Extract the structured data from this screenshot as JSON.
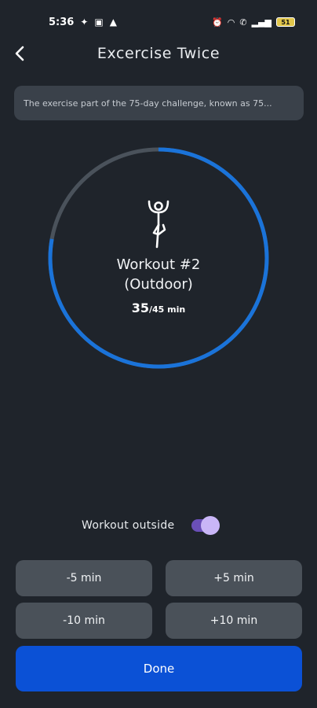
{
  "status_bar": {
    "time": "5:36",
    "battery": "51",
    "icons": [
      "messenger-icon",
      "chat-icon",
      "warning-icon",
      "alarm-icon",
      "wifi-icon",
      "call-icon",
      "signal-icon",
      "battery-icon"
    ]
  },
  "header": {
    "title": "Excercise Twice",
    "back_icon": "chevron-left-icon"
  },
  "description": "The exercise part of the 75-day challenge, known as 75...",
  "workout": {
    "name": "Workout #2",
    "type": "(Outdoor)",
    "elapsed": "35",
    "total": "/45 min",
    "progress_fraction": 0.7778,
    "icon": "yoga-pose-icon"
  },
  "toggle": {
    "label": "Workout outside",
    "on": true
  },
  "buttons": {
    "minus5": "-5 min",
    "plus5": "+5 min",
    "minus10": "-10 min",
    "plus10": "+10 min",
    "done": "Done"
  },
  "colors": {
    "background": "#1f242b",
    "ring_progress": "#1a73d9",
    "ring_track": "#4a525b",
    "toggle_track": "#6a4fb8",
    "toggle_knob": "#c9b6f7",
    "done": "#0b51d6"
  }
}
